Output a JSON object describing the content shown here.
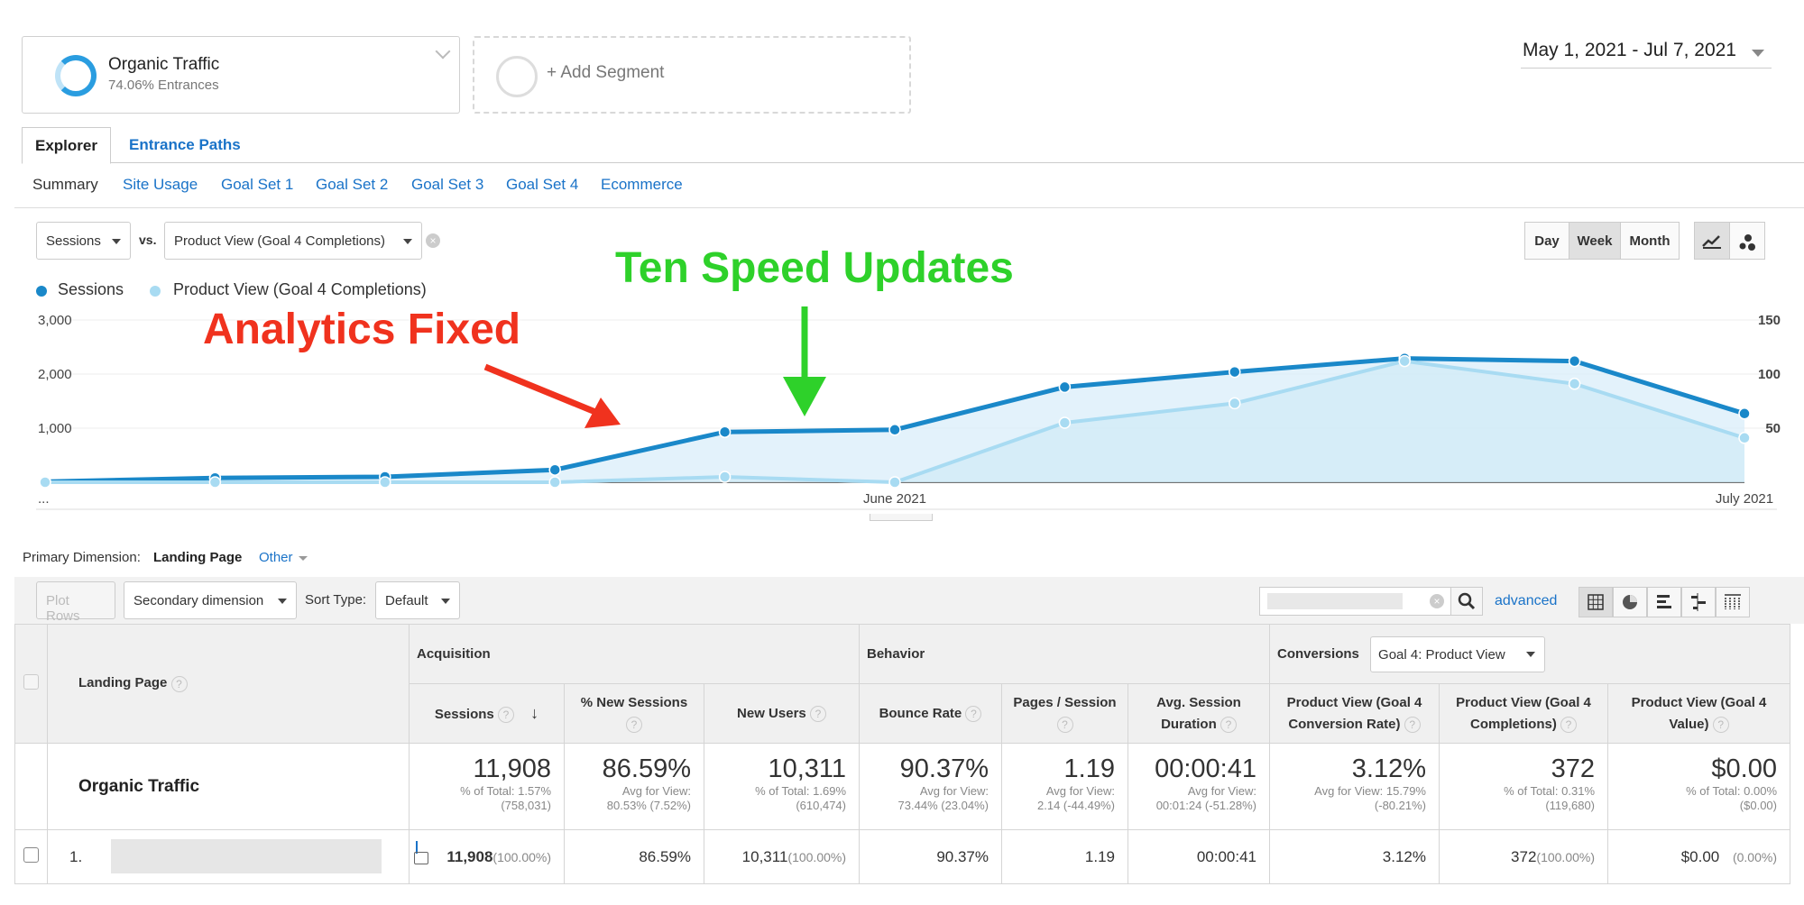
{
  "segments": {
    "primary_title": "Organic Traffic",
    "primary_sub": "74.06% Entrances",
    "add": "+ Add Segment"
  },
  "date_range": "May 1, 2021 - Jul 7, 2021",
  "tabs": [
    "Explorer",
    "Entrance Paths"
  ],
  "subnav": [
    "Summary",
    "Site Usage",
    "Goal Set 1",
    "Goal Set 2",
    "Goal Set 3",
    "Goal Set 4",
    "Ecommerce"
  ],
  "metric_select": {
    "primary": "Sessions",
    "vs": "vs.",
    "secondary": "Product View (Goal 4 Completions)"
  },
  "granularity": {
    "day": "Day",
    "week": "Week",
    "month": "Month",
    "selected": "Week"
  },
  "legend": [
    {
      "name": "Sessions",
      "color": "#1a88c9"
    },
    {
      "name": "Product View (Goal 4 Completions)",
      "color": "#a8dbf2"
    }
  ],
  "annotations": {
    "red": "Analytics Fixed",
    "green": "Ten Speed Updates",
    "red_color": "#f0321e",
    "green_color": "#2ed12a"
  },
  "chart_data": {
    "type": "line",
    "x": [
      "...",
      "",
      "",
      "",
      "",
      "June 2021",
      "",
      "",
      "",
      "",
      "July 2021"
    ],
    "x_tick_labels": [
      "...",
      "June 2021",
      "July 2021"
    ],
    "series": [
      {
        "name": "Sessions",
        "axis": "left",
        "values": [
          10,
          80,
          100,
          230,
          930,
          970,
          1760,
          2040,
          2290,
          2240,
          1270
        ]
      },
      {
        "name": "Product View (Goal 4 Completions)",
        "axis": "right",
        "values": [
          0,
          0,
          0,
          0,
          5,
          0,
          55,
          73,
          112,
          91,
          41
        ]
      }
    ],
    "y_left": {
      "ticks": [
        1000,
        2000,
        3000
      ],
      "tick_labels": [
        "1,000",
        "2,000",
        "3,000"
      ],
      "range": [
        0,
        3000
      ]
    },
    "y_right": {
      "ticks": [
        50,
        100,
        150
      ],
      "tick_labels": [
        "50",
        "100",
        "150"
      ],
      "range": [
        0,
        150
      ]
    }
  },
  "primary_dimension": {
    "label": "Primary Dimension:",
    "value": "Landing Page",
    "other": "Other"
  },
  "toolbar": {
    "plot_rows": "Plot Rows",
    "secondary_dimension": "Secondary dimension",
    "sort_type": "Sort Type:",
    "sort_value": "Default",
    "advanced": "advanced"
  },
  "table": {
    "landing_page_header": "Landing Page",
    "groups": {
      "acquisition": "Acquisition",
      "behavior": "Behavior",
      "conversions": "Conversions",
      "goal_select": "Goal 4: Product View"
    },
    "columns": [
      "Sessions",
      "% New Sessions",
      "New Users",
      "Bounce Rate",
      "Pages / Session",
      "Avg. Session Duration",
      "Product View (Goal 4 Conversion Rate)",
      "Product View (Goal 4 Completions)",
      "Product View (Goal 4 Value)"
    ],
    "totals_label": "Organic Traffic",
    "totals": [
      {
        "value": "11,908",
        "sub1": "% of Total: 1.57%",
        "sub2": "(758,031)"
      },
      {
        "value": "86.59%",
        "sub1": "Avg for View:",
        "sub2": "80.53% (7.52%)"
      },
      {
        "value": "10,311",
        "sub1": "% of Total: 1.69%",
        "sub2": "(610,474)"
      },
      {
        "value": "90.37%",
        "sub1": "Avg for View:",
        "sub2": "73.44% (23.04%)"
      },
      {
        "value": "1.19",
        "sub1": "Avg for View:",
        "sub2": "2.14 (-44.49%)"
      },
      {
        "value": "00:00:41",
        "sub1": "Avg for View:",
        "sub2": "00:01:24 (-51.28%)"
      },
      {
        "value": "3.12%",
        "sub1": "Avg for View: 15.79%",
        "sub2": "(-80.21%)"
      },
      {
        "value": "372",
        "sub1": "% of Total: 0.31%",
        "sub2": "(119,680)"
      },
      {
        "value": "$0.00",
        "sub1": "% of Total: 0.00%",
        "sub2": "($0.00)"
      }
    ],
    "row": {
      "index": "1.",
      "sessions": "11,908",
      "sessions_pct": "(100.00%)",
      "new_sessions": "86.59%",
      "new_users": "10,311",
      "new_users_pct": "(100.00%)",
      "bounce": "90.37%",
      "pages": "1.19",
      "duration": "00:00:41",
      "conv_rate": "3.12%",
      "completions": "372",
      "completions_pct": "(100.00%)",
      "value": "$0.00",
      "value_pct": "(0.00%)"
    }
  }
}
